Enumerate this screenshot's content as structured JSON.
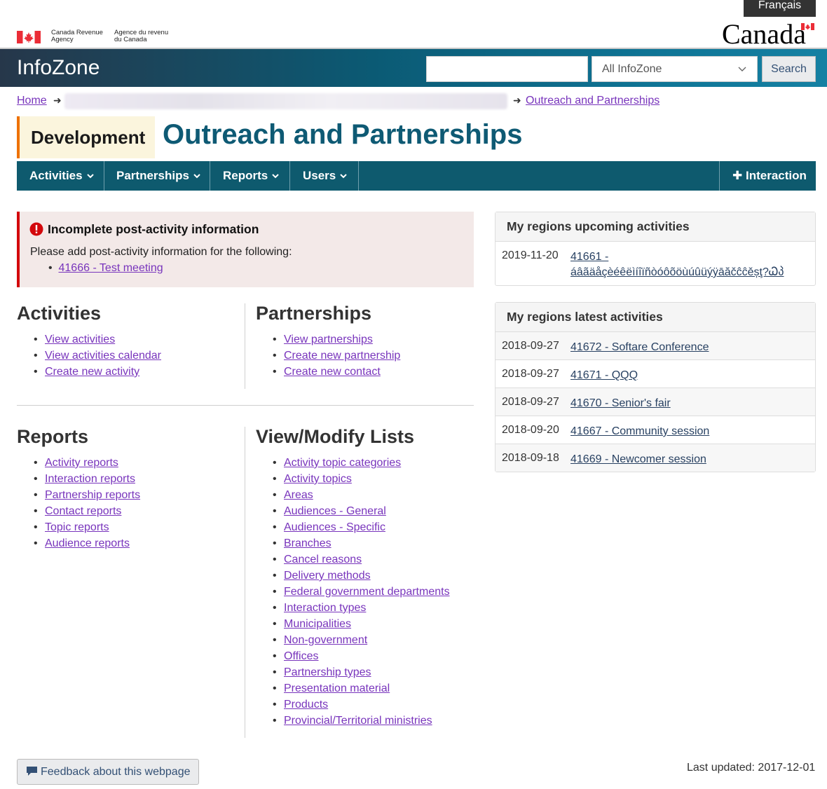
{
  "header": {
    "lang_toggle": "Français",
    "agency_en_1": "Canada Revenue",
    "agency_en_2": "Agency",
    "agency_fr_1": "Agence du revenu",
    "agency_fr_2": "du Canada",
    "wordmark": "Canada"
  },
  "banner": {
    "site_title": "InfoZone",
    "search_placeholder": "",
    "search_scope": "All InfoZone",
    "search_button": "Search"
  },
  "breadcrumb": {
    "home": "Home",
    "current": "Outreach and Partnerships"
  },
  "title": {
    "env_badge": "Development",
    "page_title": "Outreach and Partnerships"
  },
  "nav": {
    "items": [
      "Activities",
      "Partnerships",
      "Reports",
      "Users"
    ],
    "action": "Interaction"
  },
  "alert": {
    "title": "Incomplete post-activity information",
    "text": "Please add post-activity information for the following:",
    "link": "41666 - Test meeting"
  },
  "sections": {
    "activities": {
      "heading": "Activities",
      "links": [
        "View activities",
        "View activities calendar",
        "Create new activity"
      ]
    },
    "partnerships": {
      "heading": "Partnerships",
      "links": [
        "View partnerships",
        "Create new partnership",
        "Create new contact"
      ]
    },
    "reports": {
      "heading": "Reports",
      "links": [
        "Activity reports",
        "Interaction reports",
        "Partnership reports",
        "Contact reports",
        "Topic reports",
        "Audience reports"
      ]
    },
    "lists": {
      "heading": "View/Modify Lists",
      "links": [
        "Activity topic categories",
        "Activity topics",
        "Areas",
        "Audiences - General",
        "Audiences - Specific",
        "Branches",
        "Cancel reasons",
        "Delivery methods",
        "Federal government departments",
        "Interaction types",
        "Municipalities",
        "Non-government",
        "Offices",
        "Partnership types",
        "Presentation material",
        "Products",
        "Provincial/Territorial ministries"
      ]
    }
  },
  "upcoming": {
    "heading": "My regions upcoming activities",
    "rows": [
      {
        "date": "2019-11-20",
        "link_1": "41661 -",
        "link_2": "áâãäåçèéêëìíîïñòóôõöùúûüýÿāăčĉĉěșţ?Ꮗპ"
      }
    ]
  },
  "latest": {
    "heading": "My regions latest activities",
    "rows": [
      {
        "date": "2018-09-27",
        "link": "41672 - Softare Conference"
      },
      {
        "date": "2018-09-27",
        "link": "41671 - QQQ"
      },
      {
        "date": "2018-09-27",
        "link": "41670 - Senior's fair"
      },
      {
        "date": "2018-09-20",
        "link": "41667 - Community session"
      },
      {
        "date": "2018-09-18",
        "link": "41669 - Newcomer session"
      }
    ]
  },
  "footer": {
    "feedback": "Feedback about this webpage",
    "last_updated": "Last updated: 2017-12-01"
  },
  "colors": {
    "page_title": "#0e5a74",
    "nav_bg": "#0e5a6e",
    "link_visited": "#7834bc",
    "link": "#284162",
    "alert_bg": "#f3e9e8",
    "alert_border": "#d3080c",
    "badge_bg": "#fbf5dd",
    "badge_border": "#ee7100"
  },
  "icons": {
    "alert": "exclamation-circle-icon",
    "nav_chevron": "chevron-down-icon",
    "add": "plus-icon",
    "feedback": "comment-icon",
    "flag": "canada-flag-icon"
  }
}
